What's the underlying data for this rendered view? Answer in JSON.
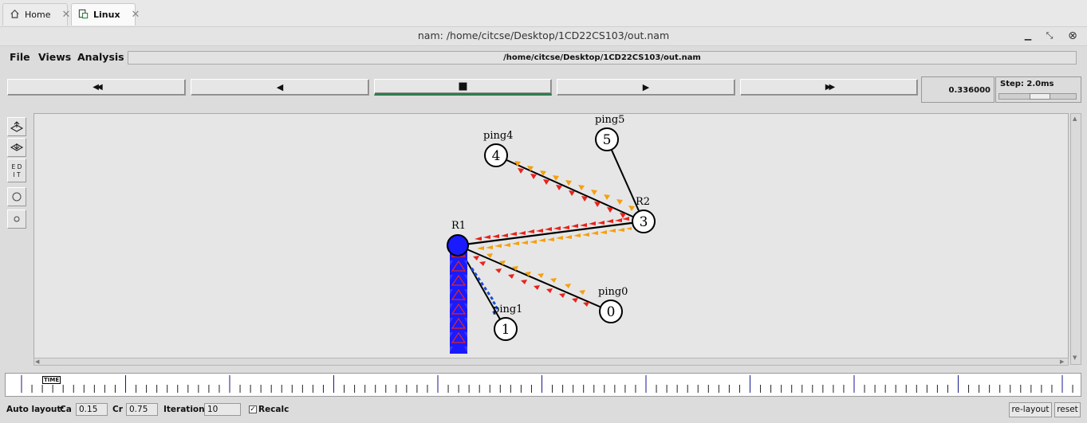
{
  "tabs": [
    {
      "label": "Home",
      "icon": "home-icon"
    },
    {
      "label": "Linux",
      "icon": "vm-icon"
    }
  ],
  "window": {
    "title": "nam: /home/citcse/Desktop/1CD22CS103/out.nam"
  },
  "menu": {
    "file": "File",
    "views": "Views",
    "analysis": "Analysis"
  },
  "path": "/home/citcse/Desktop/1CD22CS103/out.nam",
  "controls": {
    "rewind": "◀◀",
    "back": "◀",
    "stop": "■",
    "play": "▶",
    "fastforward": "▶▶"
  },
  "time_value": "0.336000",
  "step_label": "Step: 2.0ms",
  "sidebar": {
    "edit_label": "E D I T"
  },
  "nodes": [
    {
      "id": "0",
      "label": "ping0"
    },
    {
      "id": "1",
      "label": "ping1"
    },
    {
      "id": "3",
      "label": "R2"
    },
    {
      "id": "4",
      "label": "ping4"
    },
    {
      "id": "5",
      "label": "ping5"
    },
    {
      "id": "",
      "label": "R1"
    }
  ],
  "timeline": {
    "marker": "TIME"
  },
  "bottom": {
    "auto_layout": "Auto layout:",
    "ca_label": "Ca",
    "ca_value": "0.15",
    "cr_label": "Cr",
    "cr_value": "0.75",
    "iterations_label": "Iterations",
    "iterations_value": "10",
    "recalc_label": "Recalc",
    "recalc_checked": "✓",
    "relayout": "re-layout",
    "reset": "reset"
  },
  "colors": {
    "queue": "#1a1aff",
    "packet_red": "#e8231c",
    "packet_orange": "#f5a00f",
    "active_green": "#2e7d4f"
  }
}
